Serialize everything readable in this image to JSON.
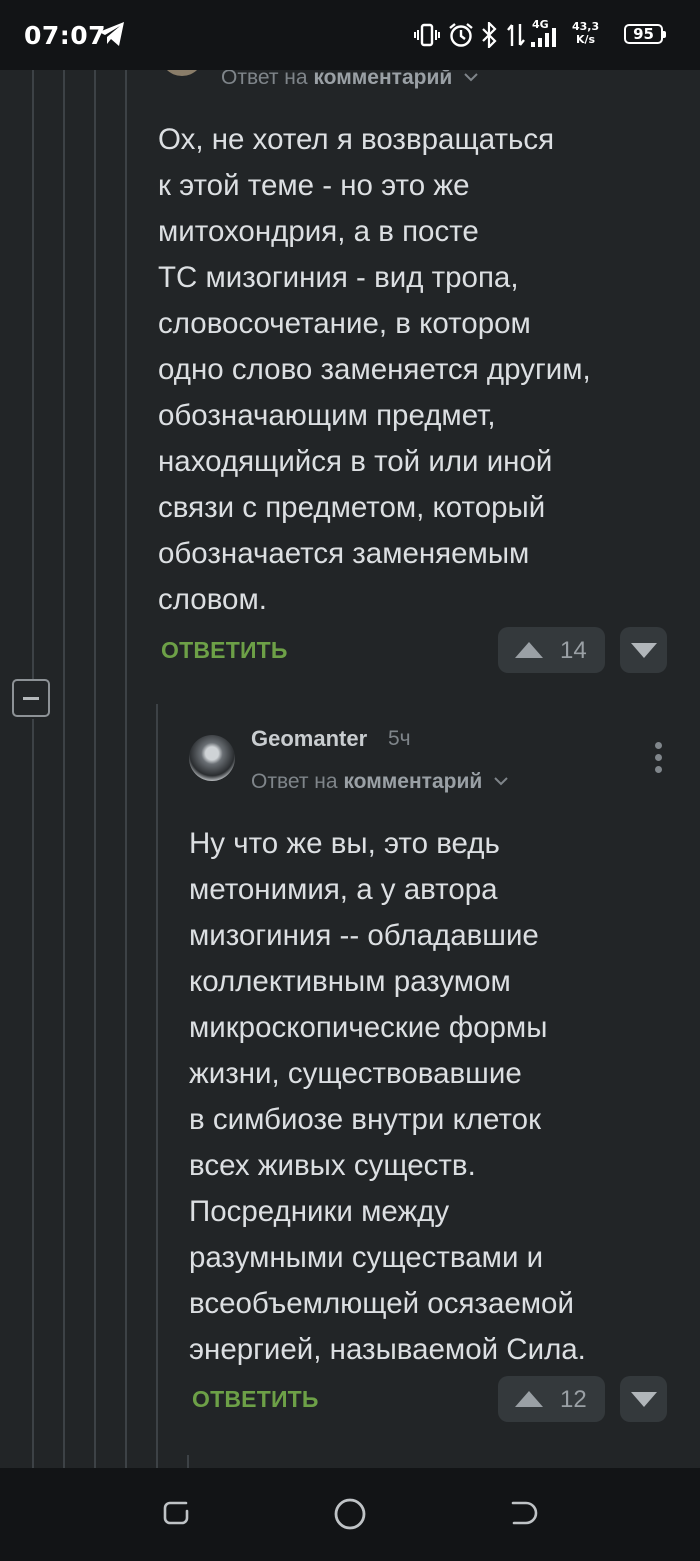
{
  "status_bar": {
    "time": "07:07",
    "network": "4G",
    "speed_value": "43,3",
    "speed_unit": "K/s",
    "battery": "95",
    "icons": [
      "telegram-icon",
      "vibrate-icon",
      "alarm-icon",
      "bluetooth-icon",
      "data-transfer-icon",
      "signal-icon"
    ]
  },
  "comment_1": {
    "reply_prefix": "Ответ на",
    "reply_target": "комментарий",
    "body_lines": [
      "Ох, не хотел я возвращаться",
      "к этой теме - но это же",
      "митохондрия, а в посте",
      "ТС мизогиния - вид тропа,",
      "словосочетание, в котором",
      "одно слово заменяется другим,",
      "обозначающим предмет,",
      "находящийся в той или иной",
      "связи с предметом, который",
      "обозначается заменяемым",
      "словом."
    ],
    "reply_label": "ОТВЕТИТЬ",
    "votes": "14"
  },
  "comment_2": {
    "username": "Geomanter",
    "time_ago": "5ч",
    "reply_prefix": "Ответ на",
    "reply_target": "комментарий",
    "body_lines": [
      "Ну что же вы, это ведь",
      "метонимия, а у автора",
      "мизогиния -- обладавшие",
      "коллективным разумом",
      "микроскопические формы",
      "жизни, существовавшие",
      "в симбиозе внутри клеток",
      "всех живых существ.",
      "Посредники между",
      "разумными существами и",
      "всеобъемлющей осязаемой",
      "энергией, называемой Сила."
    ],
    "reply_label": "ОТВЕТИТЬ",
    "votes": "12"
  },
  "colors": {
    "background": "#222527",
    "reply_button": "#6da047",
    "vote_bg": "#34393c"
  }
}
